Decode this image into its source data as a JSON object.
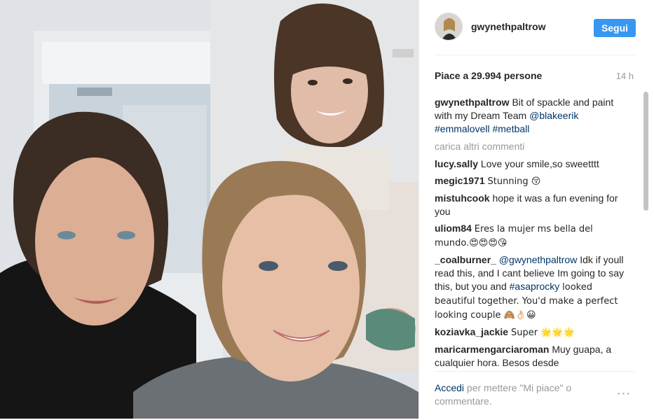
{
  "post": {
    "username": "gwynethpaltrow",
    "follow_label": "Segui",
    "likes_text": "Piace a 29.994 persone",
    "time_ago": "14 h",
    "caption": {
      "user": "gwynethpaltrow",
      "text": "Bit of spackle and paint with my Dream Team",
      "mention": "@blakeerik",
      "tags": "#emmalovell #metball"
    },
    "load_more_label": "carica altri commenti"
  },
  "comments": [
    {
      "user": "lucy.sally",
      "text": "Love your smile,so sweetttt"
    },
    {
      "user": "megic1971",
      "text": "Stunning 😚"
    },
    {
      "user": "mistuhcook",
      "text": "hope it was a fun evening for you"
    },
    {
      "user": "uliom84",
      "text": "Eres la mujer ms bella del mundo.😍😍😍😘"
    },
    {
      "user": "_coalburner_",
      "mention": "@gwynethpaltrow",
      "text_a": "Idk if youll read this, and I cant believe Im going to say this, but you and",
      "tag": "#asaprocky",
      "text_b": "looked beautiful together. You'd make a perfect looking couple 🙈👌🏻😀"
    },
    {
      "user": "koziavka_jackie",
      "text": "Super 🌟🌟🌟"
    },
    {
      "user": "maricarmengarciaroman",
      "text": "Muy guapa, a cualquier hora. Besos desde"
    }
  ],
  "footer": {
    "login_link": "Accedi",
    "login_rest": "per mettere \"Mi piace\" o commentare.",
    "more_icon": "ellipsis-icon"
  },
  "colors": {
    "follow_button": "#3897f0",
    "link": "#003569",
    "muted": "#999999"
  }
}
